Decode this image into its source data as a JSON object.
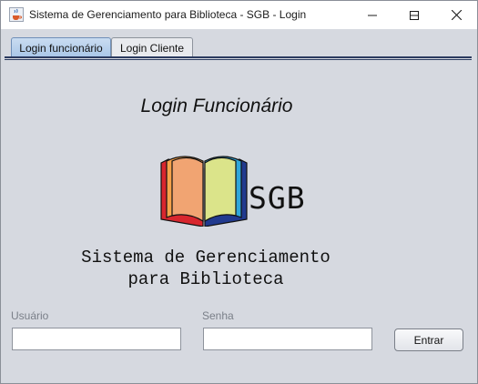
{
  "window": {
    "title": "Sistema de Gerenciamento para Biblioteca - SGB - Login",
    "app_icon": "java-cup-icon",
    "controls": [
      "minimize-icon",
      "maximize-icon",
      "close-icon"
    ]
  },
  "tabs": [
    {
      "label": "Login funcionário",
      "selected": true
    },
    {
      "label": "Login Cliente",
      "selected": false
    }
  ],
  "main": {
    "heading": "Login Funcionário",
    "logo_text": "SGB",
    "system_name": "Sistema de Gerenciamento\npara Biblioteca"
  },
  "form": {
    "user_label": "Usuário",
    "user_value": "",
    "password_label": "Senha",
    "password_value": "",
    "submit_label": "Entrar"
  },
  "colors": {
    "background": "#d6d9e0",
    "tab_selected": "#b7cfec",
    "tab_border": "#2b3a5f"
  }
}
